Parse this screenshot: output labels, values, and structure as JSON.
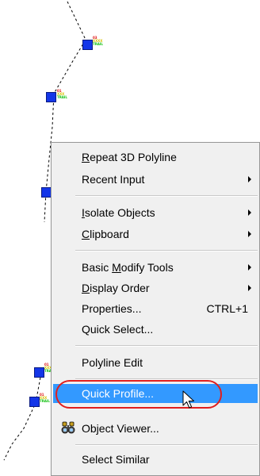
{
  "drawing": {
    "markers": [
      {
        "id": "m1",
        "tags": [
          "03",
          "XXXX",
          "TRAIL"
        ]
      },
      {
        "id": "m2",
        "tags": [
          "01",
          "XXX",
          "TRAIL"
        ]
      },
      {
        "id": "m3",
        "tags": []
      },
      {
        "id": "m4",
        "tags": [
          "01",
          "XXX",
          "TRAIL"
        ]
      },
      {
        "id": "m5",
        "tags": [
          "01",
          "XXX",
          "TRAIL"
        ]
      }
    ]
  },
  "context_menu": {
    "items": [
      {
        "label": "Repeat 3D Polyline",
        "underline": "R"
      },
      {
        "label": "Recent Input",
        "submenu": true
      },
      {
        "label": "Isolate Objects",
        "underline": "I",
        "submenu": true
      },
      {
        "label": "Clipboard",
        "underline": "C",
        "submenu": true
      },
      {
        "label": "Basic Modify Tools",
        "underline": "M",
        "submenu": true
      },
      {
        "label": "Display Order",
        "underline": "D",
        "submenu": true
      },
      {
        "label": "Properties...",
        "shortcut": "CTRL+1"
      },
      {
        "label": "Quick Select..."
      },
      {
        "label": "Polyline Edit"
      },
      {
        "label": "Quick Profile...",
        "highlighted": true
      },
      {
        "label": "Object Viewer...",
        "icon": "binoculars-icon"
      },
      {
        "label": "Select Similar"
      }
    ]
  },
  "colors": {
    "highlight": "#3399ff",
    "marker": "#1436e8",
    "annotation_oval": "#e01e1e"
  }
}
